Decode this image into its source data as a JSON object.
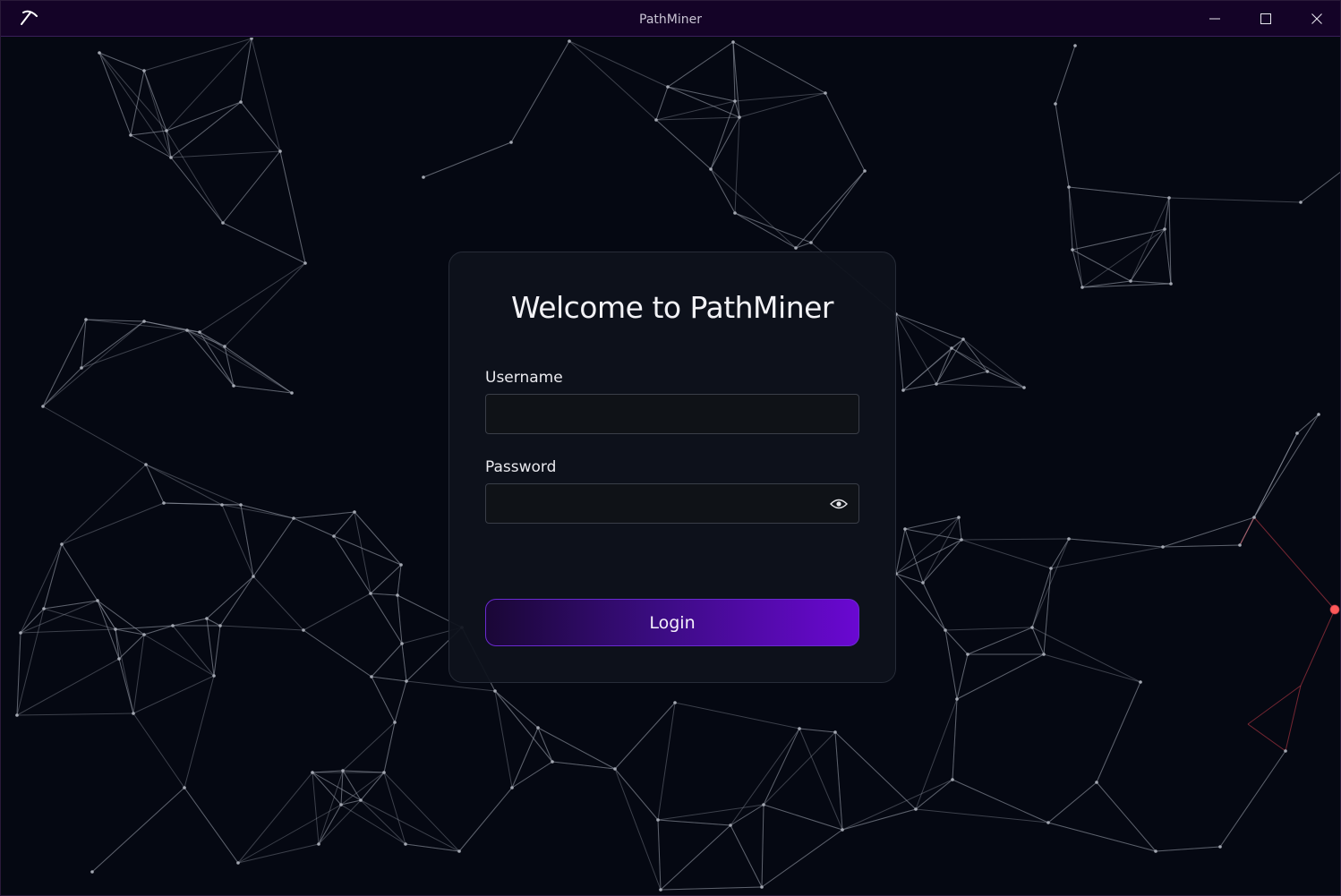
{
  "window": {
    "title": "PathMiner",
    "app_icon": "pickaxe-icon",
    "controls": [
      "minimize-icon",
      "maximize-icon",
      "close-icon"
    ]
  },
  "login_card": {
    "heading": "Welcome to PathMiner",
    "username": {
      "label": "Username",
      "value": "",
      "placeholder": ""
    },
    "password": {
      "label": "Password",
      "value": "",
      "placeholder": "",
      "toggle_icon": "eye-icon"
    },
    "login_button": "Login"
  },
  "colors": {
    "background": "#050812",
    "titlebar": "#140327",
    "accent_start": "#1a0736",
    "accent_end": "#6a08d2",
    "network_line": "#6a6f7c",
    "network_highlight": "#e0404a"
  }
}
